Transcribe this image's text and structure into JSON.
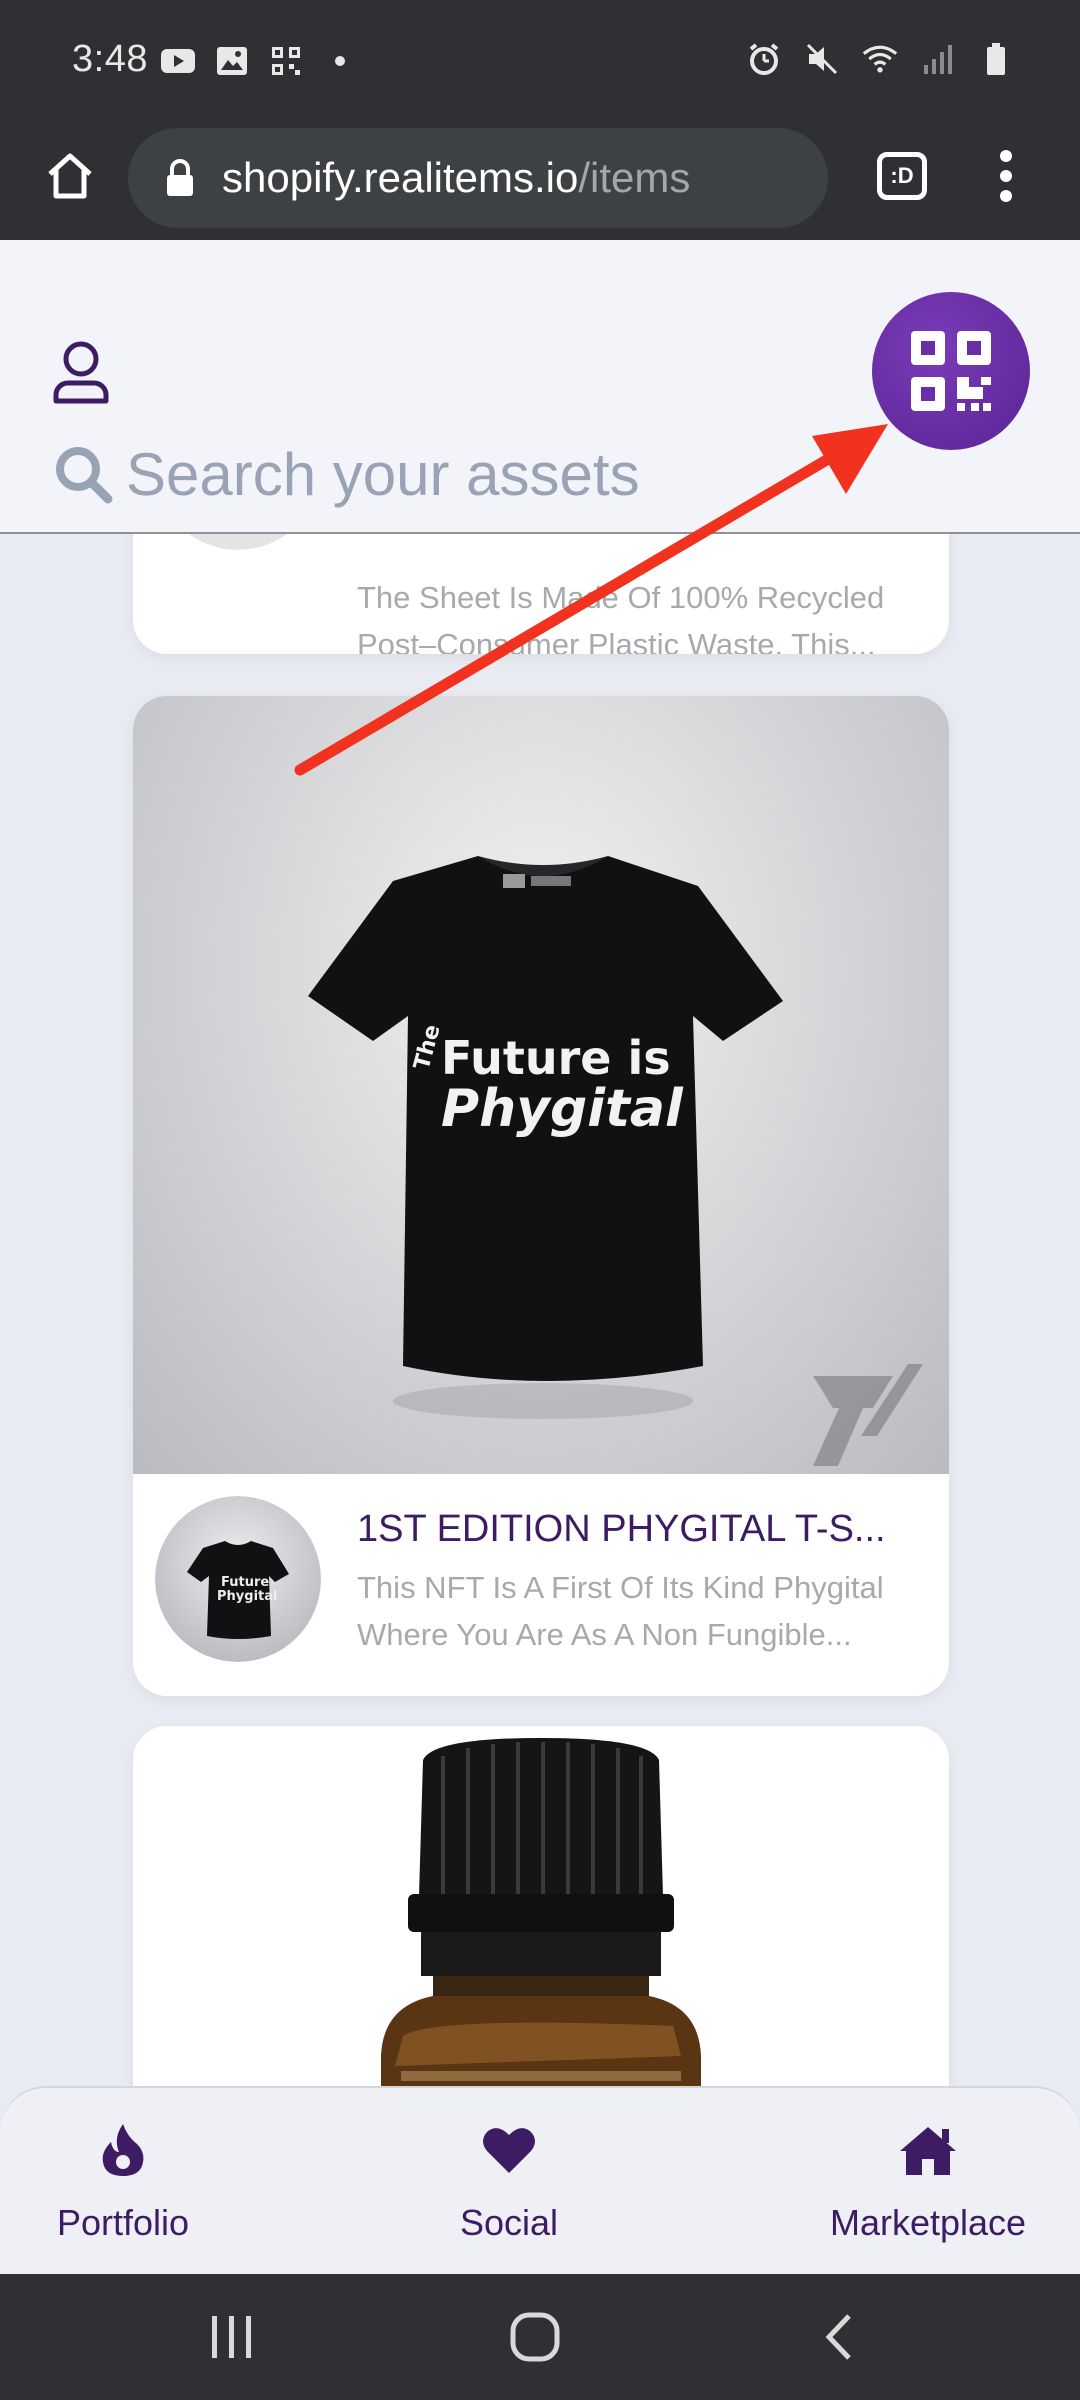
{
  "status_bar": {
    "time": "3:48",
    "icons_left": [
      "youtube-icon",
      "gallery-icon",
      "qr-notification-icon",
      "dot-icon"
    ],
    "icons_right": [
      "alarm-icon",
      "mute-icon",
      "wifi-icon",
      "signal-icon",
      "battery-icon"
    ]
  },
  "browser": {
    "url_domain": "shopify.realitems.io",
    "url_path": "/items",
    "tabs_label": ":D"
  },
  "header": {
    "search_placeholder": "Search your assets"
  },
  "cards": [
    {
      "title": "",
      "description": "The Sheet Is Made Of 100% Recycled Post–Consumer Plastic Waste. This..."
    },
    {
      "title": "1ST EDITION PHYGITAL T-S...",
      "description": "This NFT Is A First Of Its Kind Phygital Where You Are As A Non Fungible...",
      "shirt_text_line1": "The",
      "shirt_text_line2": "Future is",
      "shirt_text_line3": "Phygital"
    },
    {
      "title": "",
      "description": ""
    }
  ],
  "bottom_nav": {
    "portfolio": "Portfolio",
    "social": "Social",
    "marketplace": "Marketplace"
  },
  "colors": {
    "brand_purple": "#5a2495",
    "nav_text": "#3d1c63",
    "arrow_red": "#f0321e"
  }
}
